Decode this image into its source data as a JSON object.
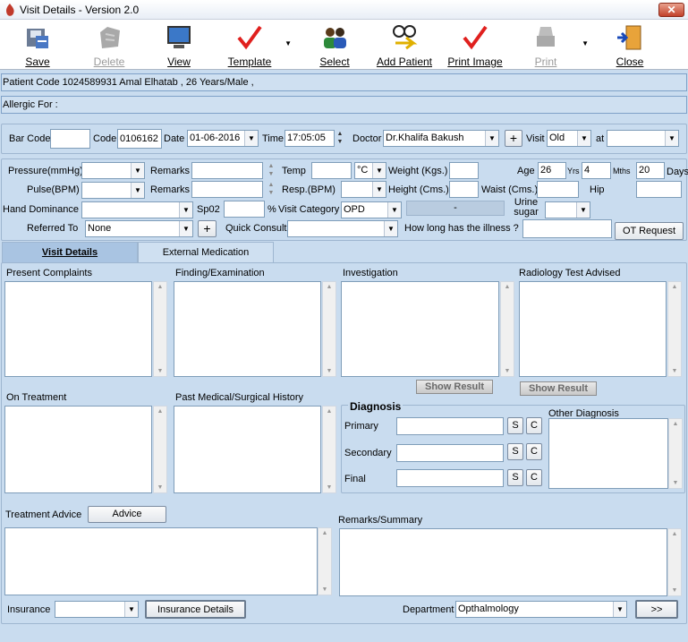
{
  "window": {
    "title": "Visit Details - Version 2.0",
    "close": "✕"
  },
  "toolbar": [
    {
      "label": "Save",
      "icon": "save-icon",
      "enabled": true
    },
    {
      "label": "Delete",
      "icon": "delete-icon",
      "enabled": false
    },
    {
      "label": "View",
      "icon": "monitor-icon",
      "enabled": true
    },
    {
      "label": "Template",
      "icon": "checkmark-icon",
      "enabled": true
    },
    {
      "label": "Select",
      "icon": "users-icon",
      "enabled": true
    },
    {
      "label": "Add Patient",
      "icon": "add-patient-icon",
      "enabled": true
    },
    {
      "label": "Print Image",
      "icon": "checkmark-icon",
      "enabled": true
    },
    {
      "label": "Print",
      "icon": "print-icon",
      "enabled": false
    },
    {
      "label": "Close",
      "icon": "door-exit-icon",
      "enabled": true
    }
  ],
  "patient": {
    "info": "Patient Code 1024589931 Amal Elhatab , 26 Years/Male       ,",
    "allergic": "Allergic For :"
  },
  "visit": {
    "barcode_label": "Bar Code",
    "barcode": "",
    "code_label": "Code",
    "code": "0106162",
    "date_label": "Date",
    "date": "01-06-2016",
    "time_label": "Time",
    "time": "17:05:05",
    "doctor_label": "Doctor",
    "doctor": "Dr.Khalifa Bakush",
    "plus": "+",
    "visit_label": "Visit",
    "visit_type": "Old",
    "at_label": "at",
    "at": ""
  },
  "vitals": {
    "pressure_label": "Pressure(mmHg)",
    "remarks_label": "Remarks",
    "pulse_label": "Pulse(BPM)",
    "temp_label": "Temp",
    "temp_unit": "°C",
    "resp_label": "Resp.(BPM)",
    "weight_label": "Weight (Kgs.)",
    "height_label": "Height (Cms.)",
    "waist_label": "Waist (Cms.)",
    "age_label": "Age",
    "age_years": "26",
    "yrs": "Yrs",
    "age_months": "4",
    "mths": "Mths",
    "age_days": "20",
    "days": "Days",
    "hip_label": "Hip",
    "hand_label": "Hand Dominance",
    "spo2_label": "Sp02",
    "percent": "%",
    "category_label": "Visit Category",
    "category": "OPD",
    "dash": "-",
    "urine_label": "Urine sugar",
    "referred_label": "Referred To",
    "referred": "None",
    "quick_label": "Quick Consult",
    "illness_label": "How long has the illness ?",
    "ot_request": "OT Request"
  },
  "tabs": [
    "Visit Details",
    "External Medication"
  ],
  "sections": {
    "present": "Present Complaints",
    "finding": "Finding/Examination",
    "investigation": "Investigation",
    "radiology": "Radiology Test Advised",
    "show_result": "Show Result",
    "on_treatment": "On Treatment",
    "past_history": "Past Medical/Surgical History",
    "diagnosis": "Diagnosis",
    "primary": "Primary",
    "secondary": "Secondary",
    "final": "Final",
    "s": "S",
    "c": "C",
    "other_diagnosis": "Other Diagnosis",
    "treatment_advice": "Treatment Advice",
    "advice_btn": "Advice",
    "remarks_summary": "Remarks/Summary"
  },
  "footer": {
    "insurance_label": "Insurance",
    "insurance_details": "Insurance Details",
    "department_label": "Department",
    "department": "Opthalmology",
    "next": ">>"
  }
}
